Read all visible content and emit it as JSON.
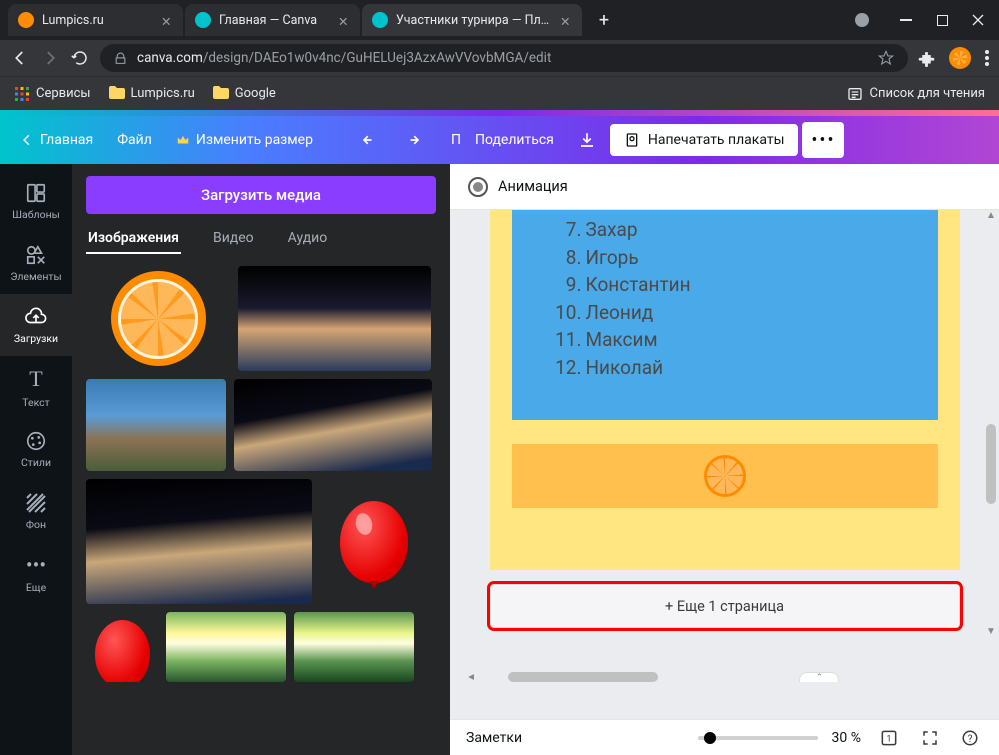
{
  "browser": {
    "tabs": [
      {
        "title": "Lumpics.ru",
        "favicon": "orange",
        "active": false
      },
      {
        "title": "Главная — Canva",
        "favicon": "canva",
        "active": false
      },
      {
        "title": "Участники турнира — Плакат",
        "favicon": "canva",
        "active": true
      }
    ],
    "url_domain": "canva.com",
    "url_path": "/design/DAEo1w0v4nc/GuHELUej3AzxAwVVovbMGA/edit",
    "bookmarks": {
      "services": "Сервисы",
      "lumpics": "Lumpics.ru",
      "google": "Google",
      "reading_list": "Список для чтения"
    }
  },
  "canva_bar": {
    "home": "Главная",
    "file": "Файл",
    "resize": "Изменить размер",
    "premium_cut": "П",
    "share": "Поделиться",
    "print": "Напечатать плакаты"
  },
  "vnav": {
    "templates": "Шаблоны",
    "elements": "Элементы",
    "uploads": "Загрузки",
    "text": "Текст",
    "styles": "Стили",
    "background": "Фон",
    "more": "Еще"
  },
  "media": {
    "upload_btn": "Загрузить медиа",
    "tabs": {
      "images": "Изображения",
      "video": "Видео",
      "audio": "Аудио"
    }
  },
  "anim_label": "Анимация",
  "poster_list": [
    {
      "n": "7.",
      "name": "Захар"
    },
    {
      "n": "8.",
      "name": "Игорь"
    },
    {
      "n": "9.",
      "name": "Константин"
    },
    {
      "n": "10.",
      "name": "Леонид"
    },
    {
      "n": "11.",
      "name": "Максим"
    },
    {
      "n": "12.",
      "name": "Николай"
    }
  ],
  "add_page": "+ Еще 1 страница",
  "bottom": {
    "notes": "Заметки",
    "zoom": "30 %",
    "page_indicator": "1"
  }
}
